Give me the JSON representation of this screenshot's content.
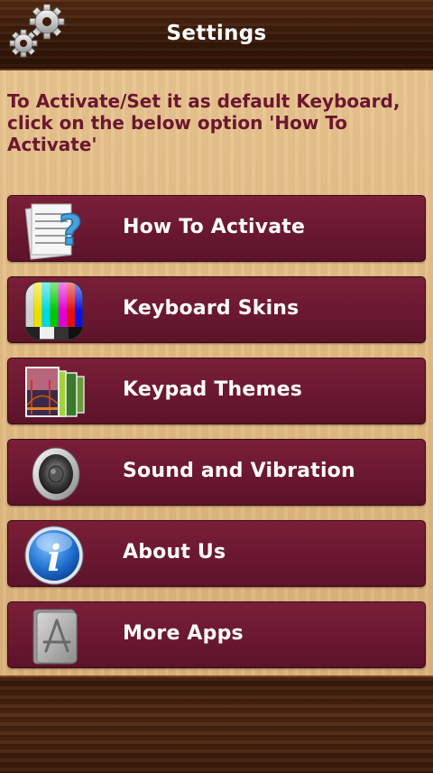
{
  "header": {
    "title": "Settings",
    "icon": "gears-icon"
  },
  "instructions": "To Activate/Set it as default Keyboard, click on the below option 'How To Activate'",
  "menu": {
    "items": [
      {
        "label": "How To Activate",
        "icon": "help-document-icon"
      },
      {
        "label": "Keyboard Skins",
        "icon": "color-bars-icon"
      },
      {
        "label": "Keypad Themes",
        "icon": "photo-gallery-icon"
      },
      {
        "label": "Sound and Vibration",
        "icon": "speaker-icon"
      },
      {
        "label": "About Us",
        "icon": "info-icon"
      },
      {
        "label": "More Apps",
        "icon": "app-store-icon"
      }
    ]
  },
  "colors": {
    "button": "#6a1830",
    "instruction_text": "#6b1730",
    "header_wood": "#3d1c0b"
  }
}
